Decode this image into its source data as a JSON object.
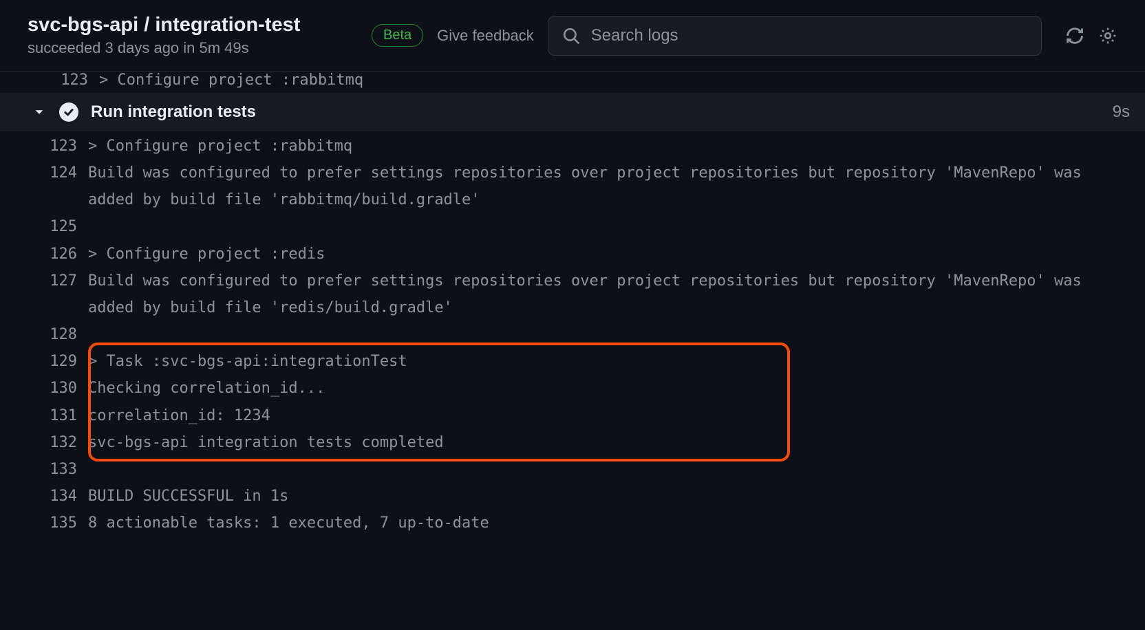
{
  "header": {
    "title": "svc-bgs-api / integration-test",
    "subtitle": "succeeded 3 days ago in 5m 49s",
    "beta_label": "Beta",
    "feedback_label": "Give feedback",
    "search_placeholder": "Search logs"
  },
  "partial_log": {
    "line_number": "123",
    "text": "> Configure project :rabbitmq"
  },
  "step": {
    "title": "Run integration tests",
    "duration": "9s"
  },
  "log_lines": [
    {
      "n": "123",
      "t": "> Configure project :rabbitmq"
    },
    {
      "n": "124",
      "t": "Build was configured to prefer settings repositories over project repositories but repository 'MavenRepo' was added by build file 'rabbitmq/build.gradle'"
    },
    {
      "n": "125",
      "t": ""
    },
    {
      "n": "126",
      "t": "> Configure project :redis"
    },
    {
      "n": "127",
      "t": "Build was configured to prefer settings repositories over project repositories but repository 'MavenRepo' was added by build file 'redis/build.gradle'"
    },
    {
      "n": "128",
      "t": ""
    },
    {
      "n": "129",
      "t": "> Task :svc-bgs-api:integrationTest"
    },
    {
      "n": "130",
      "t": "Checking correlation_id..."
    },
    {
      "n": "131",
      "t": "correlation_id: 1234"
    },
    {
      "n": "132",
      "t": "svc-bgs-api integration tests completed"
    },
    {
      "n": "133",
      "t": ""
    },
    {
      "n": "134",
      "t": "BUILD SUCCESSFUL in 1s"
    },
    {
      "n": "135",
      "t": "8 actionable tasks: 1 executed, 7 up-to-date"
    }
  ],
  "highlight": {
    "start_line": "129",
    "end_line": "132"
  }
}
